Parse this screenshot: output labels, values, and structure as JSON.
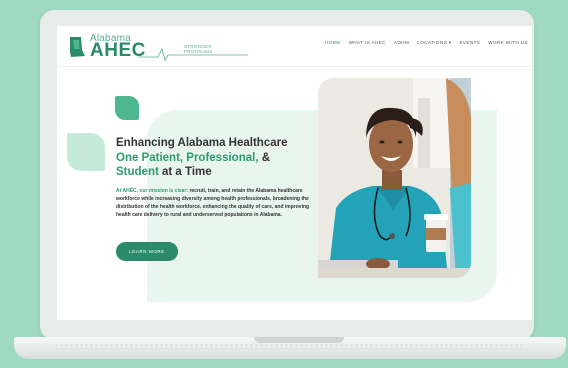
{
  "logo": {
    "small": "Alabama",
    "big": "AHEC",
    "tagline": "STRONGER PROGRAMS"
  },
  "nav": [
    {
      "label": "HOME",
      "active": true
    },
    {
      "label": "WHAT IS AHEC",
      "active": false
    },
    {
      "label": "AOHM",
      "active": false
    },
    {
      "label": "LOCATIONS ▾",
      "active": false
    },
    {
      "label": "EVENTS",
      "active": false
    },
    {
      "label": "WORK WITH US",
      "active": false
    }
  ],
  "hero": {
    "headline_line1": "Enhancing Alabama Healthcare",
    "headline_line2_a": "One Patient, Professional,",
    "headline_line2_b": " &",
    "headline_line3_a": "Student",
    "headline_line3_b": " at a Time",
    "mission_lead": "At AHEC, our mission is clear:",
    "mission_body": " recruit, train, and retain the Alabama healthcare workforce while increasing diversity among health professionals, broadening the distribution of the health workforce, enhancing the quality of care, and improving health care delivery to rural and underserved populations in Alabama.",
    "button_label": "LEARN MORE"
  },
  "colors": {
    "brand": "#2a8a6a",
    "accent": "#4fb78d",
    "background": "#9fd9c1"
  }
}
